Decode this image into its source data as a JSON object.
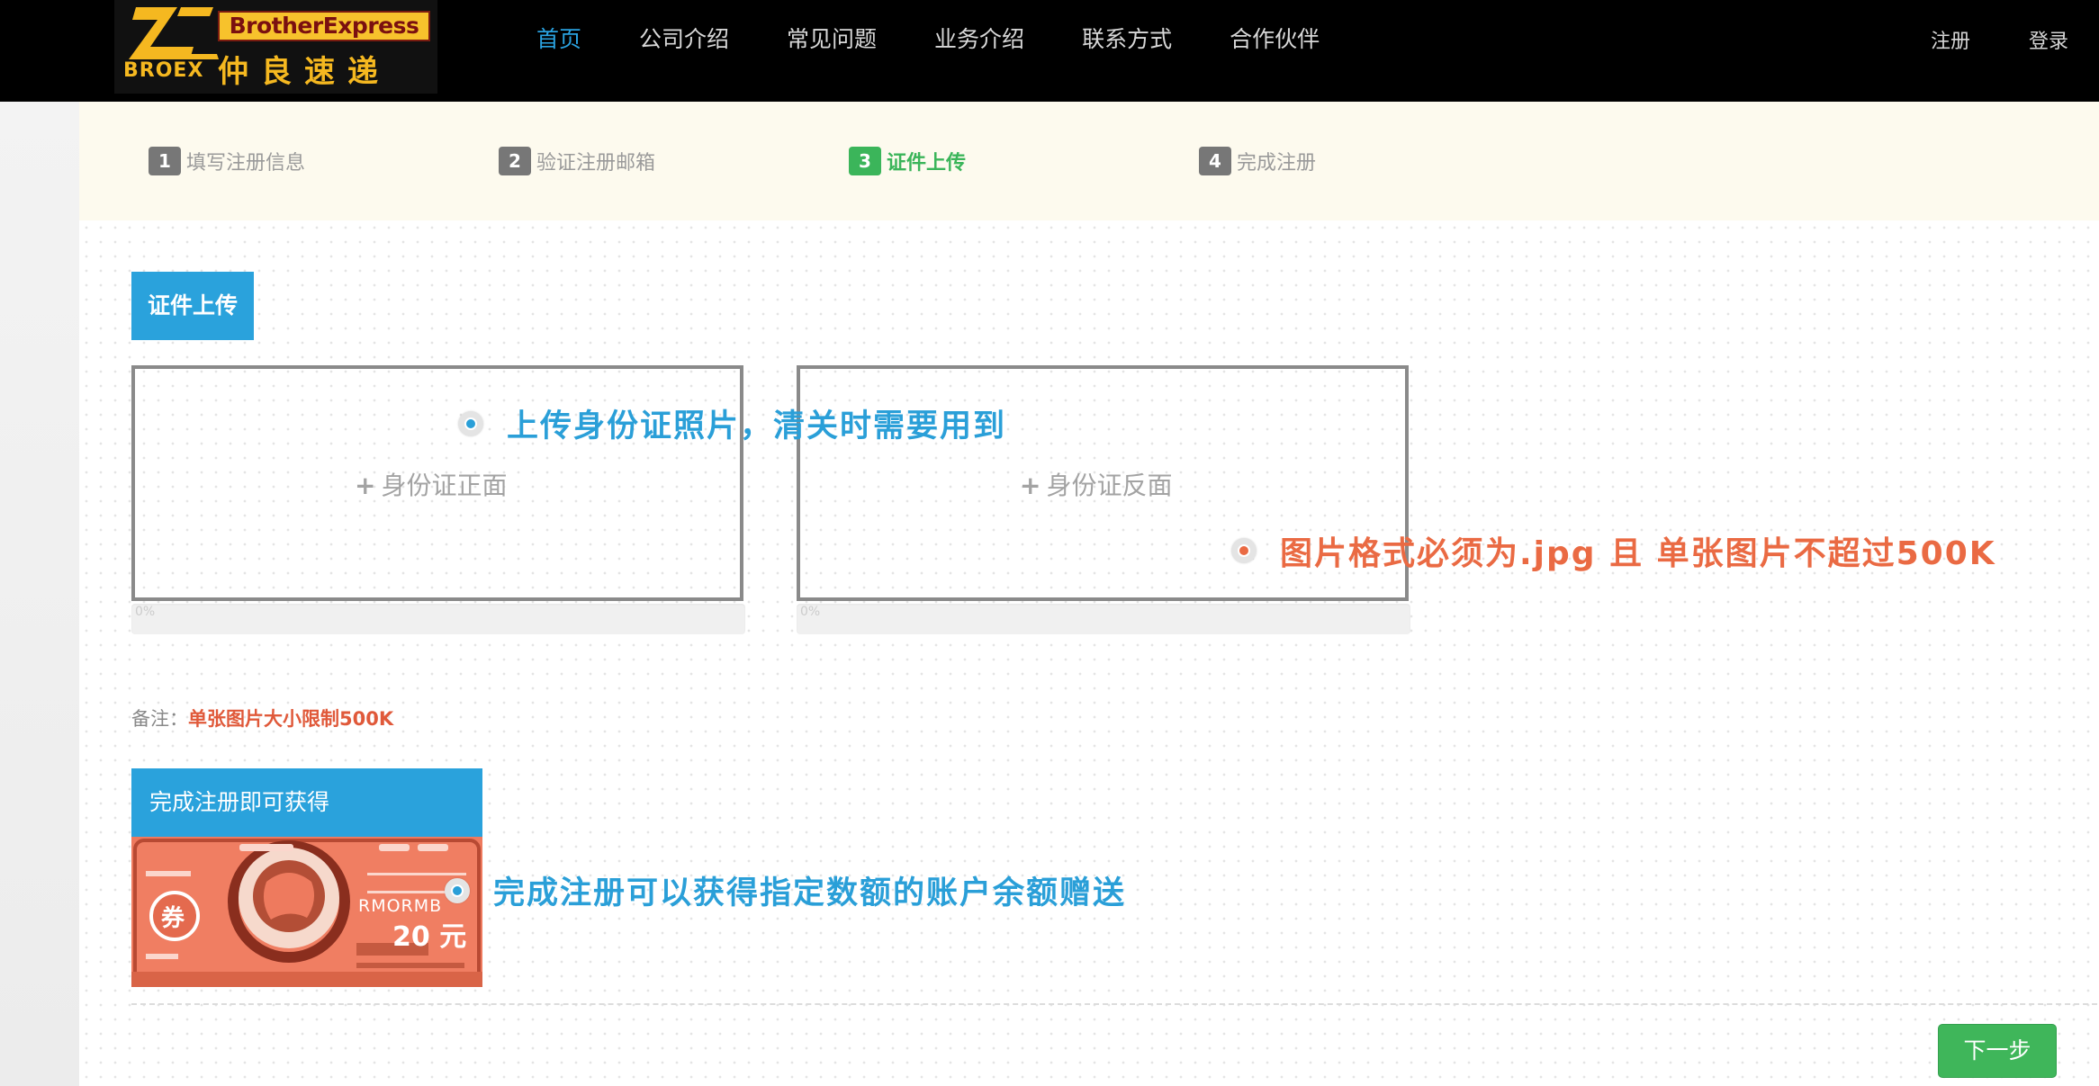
{
  "logo": {
    "mark_text": "BROEX",
    "en_name": "BrotherExpress",
    "cn_name": "仲良速递"
  },
  "nav": {
    "items": [
      {
        "label": "首页",
        "active": true
      },
      {
        "label": "公司介绍",
        "active": false
      },
      {
        "label": "常见问题",
        "active": false
      },
      {
        "label": "业务介绍",
        "active": false
      },
      {
        "label": "联系方式",
        "active": false
      },
      {
        "label": "合作伙伴",
        "active": false
      }
    ],
    "register": "注册",
    "login": "登录"
  },
  "steps": [
    {
      "num": "1",
      "label": "填写注册信息"
    },
    {
      "num": "2",
      "label": "验证注册邮箱"
    },
    {
      "num": "3",
      "label": "证件上传",
      "current": true
    },
    {
      "num": "4",
      "label": "完成注册"
    }
  ],
  "upload": {
    "section_title": "证件上传",
    "front_label": "身份证正面",
    "back_label": "身份证反面",
    "plus": "+",
    "progress_front": "0%",
    "progress_back": "0%"
  },
  "callouts": {
    "id_photo": "上传身份证照片，清关时需要用到",
    "format": "图片格式必须为.jpg 且 单张图片不超过500K",
    "reward": "完成注册可以获得指定数额的账户余额赠送"
  },
  "remark": {
    "key": "备注：",
    "value": "单张图片大小限制500K"
  },
  "reward": {
    "title": "完成注册即可获得",
    "coupon_badge": "券",
    "coupon_currency": "RMORMB",
    "coupon_amount": "20 元"
  },
  "actions": {
    "next": "下一步"
  },
  "colors": {
    "accent_blue": "#2aa2dc",
    "step_active_green": "#3bb55a",
    "warning_orange": "#ea6a43",
    "brand_yellow": "#f5b820"
  }
}
